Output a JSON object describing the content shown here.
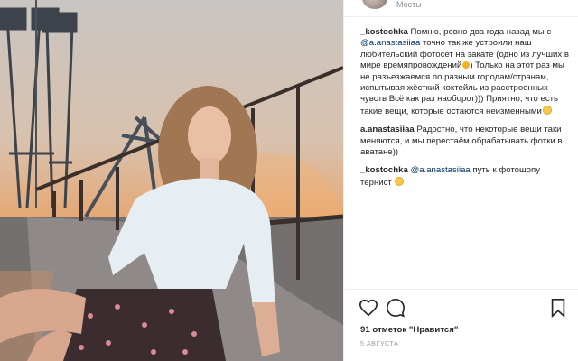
{
  "post": {
    "location": "Мосты"
  },
  "comments": [
    {
      "username": "_kostochka",
      "segments": [
        {
          "t": "text",
          "v": " Помню, ровно два года назад мы с "
        },
        {
          "t": "mention",
          "v": "@a.anastasiiaa"
        },
        {
          "t": "text",
          "v": " точно так же устроили наш любительский фотосет на закате (одно из лучших в мире времяпровождений"
        },
        {
          "t": "emoji",
          "v": "heart"
        },
        {
          "t": "text",
          "v": ") Только на этот раз мы не разъезжаемся по разным городам/странам, испытывая жёсткий коктейль из расстроенных чувств Всё как раз наоборот))) Приятно, что есть такие вещи, которые остаются неизменными"
        },
        {
          "t": "emoji",
          "v": "smile"
        }
      ]
    },
    {
      "username": "a.anastasiiaa",
      "segments": [
        {
          "t": "text",
          "v": " Радостно, что некоторые вещи таки меняются, и мы перестаём обрабатывать фотки в аватане))"
        }
      ]
    },
    {
      "username": "_kostochka",
      "segments": [
        {
          "t": "text",
          "v": " "
        },
        {
          "t": "mention",
          "v": "@a.anastasiiaa"
        },
        {
          "t": "text",
          "v": " путь к фотошопу тернист "
        },
        {
          "t": "emoji",
          "v": "smile"
        }
      ]
    }
  ],
  "likes_text": "91 отметок \"Нравится\"",
  "date_text": "5 АВГУСТА",
  "colors": {
    "mention": "#003569",
    "muted": "#8e8e8e",
    "text": "#262626"
  },
  "icons": [
    "heart-icon",
    "comment-icon",
    "bookmark-icon"
  ]
}
